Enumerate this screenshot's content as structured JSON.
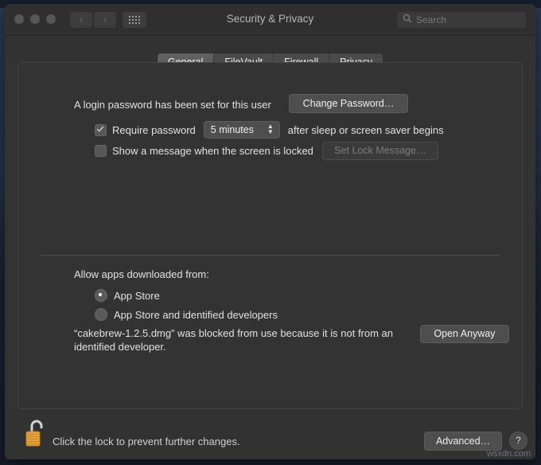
{
  "window": {
    "title": "Security & Privacy",
    "traffic_lights": [
      "close",
      "minimize",
      "zoom"
    ],
    "nav": {
      "back": "‹",
      "forward": "›"
    },
    "grid_button": "show-all-icon",
    "search": {
      "placeholder": "Search",
      "value": "",
      "icon": "search-icon"
    }
  },
  "tabs": [
    {
      "label": "General",
      "active": true
    },
    {
      "label": "FileVault",
      "active": false
    },
    {
      "label": "Firewall",
      "active": false
    },
    {
      "label": "Privacy",
      "active": false
    }
  ],
  "general": {
    "login_password_text": "A login password has been set for this user",
    "change_password_button": "Change Password…",
    "require_password": {
      "checked": true,
      "label": "Require password",
      "interval": "5 minutes",
      "suffix": "after sleep or screen saver begins",
      "chevron_icon": "chevron-up-down-icon"
    },
    "lock_message": {
      "checked": false,
      "label": "Show a message when the screen is locked",
      "button": "Set Lock Message…",
      "button_disabled": true
    },
    "allow_apps_label": "Allow apps downloaded from:",
    "sources": [
      {
        "label": "App Store",
        "selected": true
      },
      {
        "label": "App Store and identified developers",
        "selected": false
      }
    ],
    "blocked_message": "“cakebrew-1.2.5.dmg” was blocked from use because it is not from an identified developer.",
    "open_anyway_button": "Open Anyway"
  },
  "bottom_bar": {
    "lock_icon": "unlocked-padlock-icon",
    "lock_text": "Click the lock to prevent further changes.",
    "advanced_button": "Advanced…",
    "help_button": "?"
  },
  "watermark": "wsxdn.com",
  "colors": {
    "window_bg": "#323232",
    "titlebar_bg": "#2f2f2f",
    "panel_bg": "#333333",
    "control_bg": "#4e4e4e",
    "text": "#e2e2e2",
    "lock_gold": "#e09f3e"
  }
}
